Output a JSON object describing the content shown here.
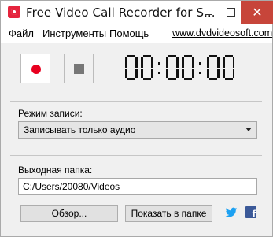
{
  "window": {
    "title": "Free Video Call Recorder for S...",
    "close_glyph": "✕"
  },
  "menu": {
    "file": "Файл",
    "tools": "Инструменты",
    "help": "Помощь",
    "website": "www.dvdvideosoft.com"
  },
  "controls": {
    "timer": "00:00:00"
  },
  "record_mode": {
    "label": "Режим записи:",
    "selected": "Записывать только аудио"
  },
  "output": {
    "label": "Выходная папка:",
    "path": "C:/Users/20080/Videos"
  },
  "buttons": {
    "browse": "Обзор...",
    "show_in_folder": "Показать в папке"
  },
  "icons": {
    "app": "app-record-icon",
    "twitter": "twitter-icon",
    "facebook": "facebook-icon",
    "facebook_glyph": "f"
  },
  "colors": {
    "record": "#e80020",
    "close_button": "#c7453a",
    "twitter": "#1da1f2",
    "facebook": "#3b5998"
  }
}
